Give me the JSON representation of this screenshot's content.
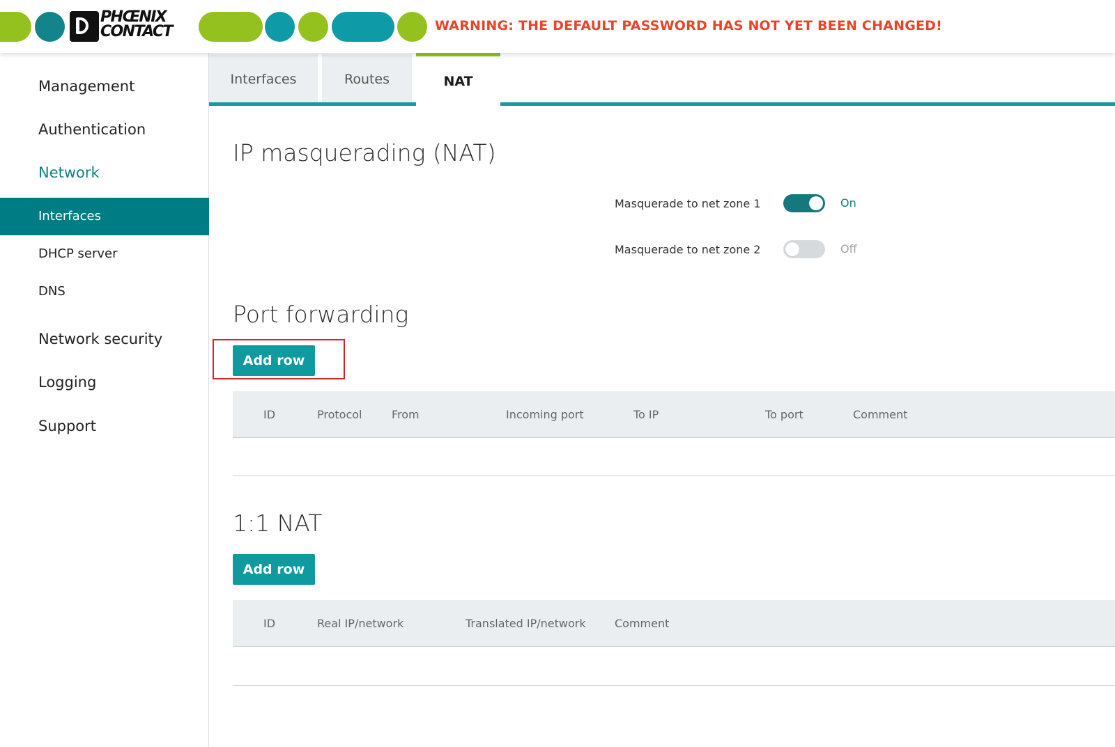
{
  "header": {
    "logo_text_line1": "PHŒNIX",
    "logo_text_line2": "CONTACT",
    "warning": "WARNING: THE DEFAULT PASSWORD HAS NOT YET BEEN CHANGED!",
    "colors": {
      "green": "#95c11f",
      "teal": "#0e9aa7",
      "dark_teal": "#13838c",
      "warning": "#e8442a"
    }
  },
  "sidebar": {
    "management": "Management",
    "authentication": "Authentication",
    "network": "Network",
    "sub_items": [
      "Interfaces",
      "DHCP server",
      "DNS"
    ],
    "network_security": "Network security",
    "logging": "Logging",
    "support": "Support"
  },
  "tabs": [
    "Interfaces",
    "Routes",
    "NAT"
  ],
  "nat": {
    "title": "IP masquerading (NAT)",
    "zone1_label": "Masquerade to net zone 1",
    "zone1_state": "On",
    "zone2_label": "Masquerade to net zone 2",
    "zone2_state": "Off"
  },
  "port_forwarding": {
    "title": "Port forwarding",
    "add_button": "Add row",
    "columns": [
      "ID",
      "Protocol",
      "From",
      "Incoming port",
      "To IP",
      "To port",
      "Comment"
    ]
  },
  "one_to_one": {
    "title": "1:1 NAT",
    "add_button": "Add row",
    "columns": [
      "ID",
      "Real IP/network",
      "Translated IP/network",
      "Comment"
    ]
  }
}
